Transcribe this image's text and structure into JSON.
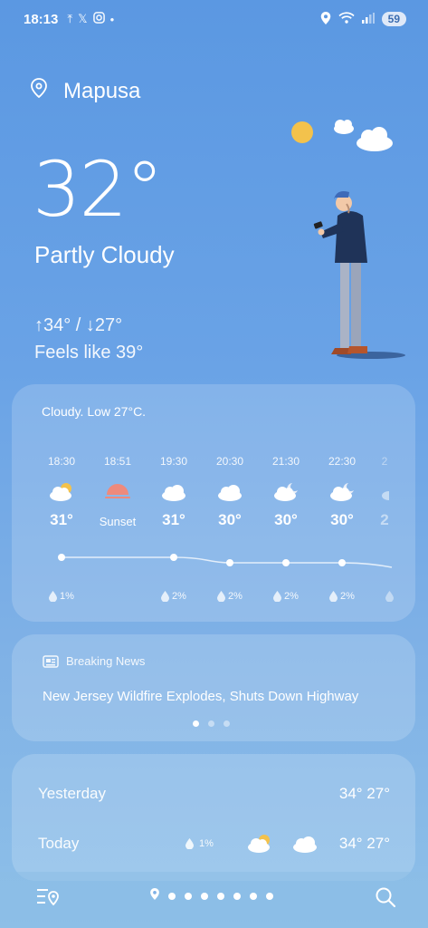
{
  "status_bar": {
    "time": "18:13",
    "battery": "59",
    "icons": [
      "upload-icon",
      "x-icon",
      "instagram-icon",
      "dot-icon",
      "location-icon",
      "wifi-icon",
      "signal-icon"
    ]
  },
  "location": {
    "name": "Mapusa"
  },
  "current": {
    "temperature": "32°",
    "condition": "Partly Cloudy",
    "high_low": "↑34° / ↓27°",
    "feels_like": "Feels like 39°"
  },
  "hourly": {
    "summary": "Cloudy. Low 27°C.",
    "items": [
      {
        "time": "18:30",
        "icon": "partly-cloudy-sun-icon",
        "value": "31°",
        "rain": "1%"
      },
      {
        "time": "18:51",
        "icon": "sunset-icon",
        "value": "Sunset",
        "rain": ""
      },
      {
        "time": "19:30",
        "icon": "cloud-icon",
        "value": "31°",
        "rain": "2%"
      },
      {
        "time": "20:30",
        "icon": "cloud-icon",
        "value": "30°",
        "rain": "2%"
      },
      {
        "time": "21:30",
        "icon": "partly-cloudy-moon-icon",
        "value": "30°",
        "rain": "2%"
      },
      {
        "time": "22:30",
        "icon": "partly-cloudy-moon-icon",
        "value": "30°",
        "rain": "2%"
      },
      {
        "time": "2",
        "icon": "partly-cloudy-moon-icon",
        "value": "2",
        "rain": ""
      }
    ]
  },
  "news": {
    "label": "Breaking News",
    "headline": "New Jersey Wildfire Explodes, Shuts Down Highway",
    "page_count": 3,
    "active_page": 1
  },
  "daily": [
    {
      "day": "Yesterday",
      "temps": "34° 27°"
    },
    {
      "day": "Today",
      "rain": "1%",
      "day_icon": "partly-cloudy-sun-icon",
      "night_icon": "cloud-icon",
      "temps": "34° 27°"
    }
  ],
  "bottom_nav": {
    "location_pages": 8,
    "icons": [
      "manage-locations-icon",
      "search-icon"
    ]
  },
  "colors": {
    "background_top": "#5b98e2",
    "background_bottom": "#8ec0e8",
    "sun": "#f3c24c",
    "sunset": "#ee8a7c"
  }
}
